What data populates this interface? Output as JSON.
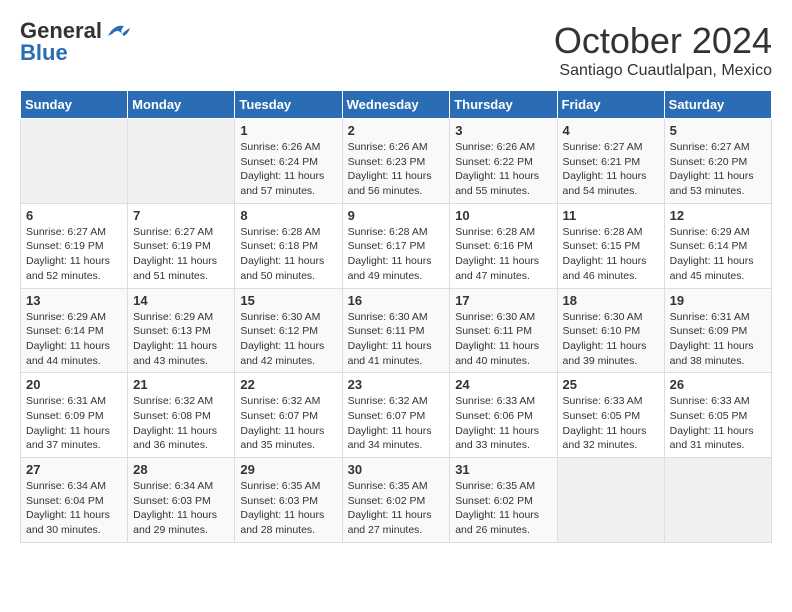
{
  "header": {
    "logo_general": "General",
    "logo_blue": "Blue",
    "month_title": "October 2024",
    "location": "Santiago Cuautlalpan, Mexico"
  },
  "days_of_week": [
    "Sunday",
    "Monday",
    "Tuesday",
    "Wednesday",
    "Thursday",
    "Friday",
    "Saturday"
  ],
  "weeks": [
    [
      {
        "day": "",
        "info": ""
      },
      {
        "day": "",
        "info": ""
      },
      {
        "day": "1",
        "info": "Sunrise: 6:26 AM\nSunset: 6:24 PM\nDaylight: 11 hours and 57 minutes."
      },
      {
        "day": "2",
        "info": "Sunrise: 6:26 AM\nSunset: 6:23 PM\nDaylight: 11 hours and 56 minutes."
      },
      {
        "day": "3",
        "info": "Sunrise: 6:26 AM\nSunset: 6:22 PM\nDaylight: 11 hours and 55 minutes."
      },
      {
        "day": "4",
        "info": "Sunrise: 6:27 AM\nSunset: 6:21 PM\nDaylight: 11 hours and 54 minutes."
      },
      {
        "day": "5",
        "info": "Sunrise: 6:27 AM\nSunset: 6:20 PM\nDaylight: 11 hours and 53 minutes."
      }
    ],
    [
      {
        "day": "6",
        "info": "Sunrise: 6:27 AM\nSunset: 6:19 PM\nDaylight: 11 hours and 52 minutes."
      },
      {
        "day": "7",
        "info": "Sunrise: 6:27 AM\nSunset: 6:19 PM\nDaylight: 11 hours and 51 minutes."
      },
      {
        "day": "8",
        "info": "Sunrise: 6:28 AM\nSunset: 6:18 PM\nDaylight: 11 hours and 50 minutes."
      },
      {
        "day": "9",
        "info": "Sunrise: 6:28 AM\nSunset: 6:17 PM\nDaylight: 11 hours and 49 minutes."
      },
      {
        "day": "10",
        "info": "Sunrise: 6:28 AM\nSunset: 6:16 PM\nDaylight: 11 hours and 47 minutes."
      },
      {
        "day": "11",
        "info": "Sunrise: 6:28 AM\nSunset: 6:15 PM\nDaylight: 11 hours and 46 minutes."
      },
      {
        "day": "12",
        "info": "Sunrise: 6:29 AM\nSunset: 6:14 PM\nDaylight: 11 hours and 45 minutes."
      }
    ],
    [
      {
        "day": "13",
        "info": "Sunrise: 6:29 AM\nSunset: 6:14 PM\nDaylight: 11 hours and 44 minutes."
      },
      {
        "day": "14",
        "info": "Sunrise: 6:29 AM\nSunset: 6:13 PM\nDaylight: 11 hours and 43 minutes."
      },
      {
        "day": "15",
        "info": "Sunrise: 6:30 AM\nSunset: 6:12 PM\nDaylight: 11 hours and 42 minutes."
      },
      {
        "day": "16",
        "info": "Sunrise: 6:30 AM\nSunset: 6:11 PM\nDaylight: 11 hours and 41 minutes."
      },
      {
        "day": "17",
        "info": "Sunrise: 6:30 AM\nSunset: 6:11 PM\nDaylight: 11 hours and 40 minutes."
      },
      {
        "day": "18",
        "info": "Sunrise: 6:30 AM\nSunset: 6:10 PM\nDaylight: 11 hours and 39 minutes."
      },
      {
        "day": "19",
        "info": "Sunrise: 6:31 AM\nSunset: 6:09 PM\nDaylight: 11 hours and 38 minutes."
      }
    ],
    [
      {
        "day": "20",
        "info": "Sunrise: 6:31 AM\nSunset: 6:09 PM\nDaylight: 11 hours and 37 minutes."
      },
      {
        "day": "21",
        "info": "Sunrise: 6:32 AM\nSunset: 6:08 PM\nDaylight: 11 hours and 36 minutes."
      },
      {
        "day": "22",
        "info": "Sunrise: 6:32 AM\nSunset: 6:07 PM\nDaylight: 11 hours and 35 minutes."
      },
      {
        "day": "23",
        "info": "Sunrise: 6:32 AM\nSunset: 6:07 PM\nDaylight: 11 hours and 34 minutes."
      },
      {
        "day": "24",
        "info": "Sunrise: 6:33 AM\nSunset: 6:06 PM\nDaylight: 11 hours and 33 minutes."
      },
      {
        "day": "25",
        "info": "Sunrise: 6:33 AM\nSunset: 6:05 PM\nDaylight: 11 hours and 32 minutes."
      },
      {
        "day": "26",
        "info": "Sunrise: 6:33 AM\nSunset: 6:05 PM\nDaylight: 11 hours and 31 minutes."
      }
    ],
    [
      {
        "day": "27",
        "info": "Sunrise: 6:34 AM\nSunset: 6:04 PM\nDaylight: 11 hours and 30 minutes."
      },
      {
        "day": "28",
        "info": "Sunrise: 6:34 AM\nSunset: 6:03 PM\nDaylight: 11 hours and 29 minutes."
      },
      {
        "day": "29",
        "info": "Sunrise: 6:35 AM\nSunset: 6:03 PM\nDaylight: 11 hours and 28 minutes."
      },
      {
        "day": "30",
        "info": "Sunrise: 6:35 AM\nSunset: 6:02 PM\nDaylight: 11 hours and 27 minutes."
      },
      {
        "day": "31",
        "info": "Sunrise: 6:35 AM\nSunset: 6:02 PM\nDaylight: 11 hours and 26 minutes."
      },
      {
        "day": "",
        "info": ""
      },
      {
        "day": "",
        "info": ""
      }
    ]
  ]
}
